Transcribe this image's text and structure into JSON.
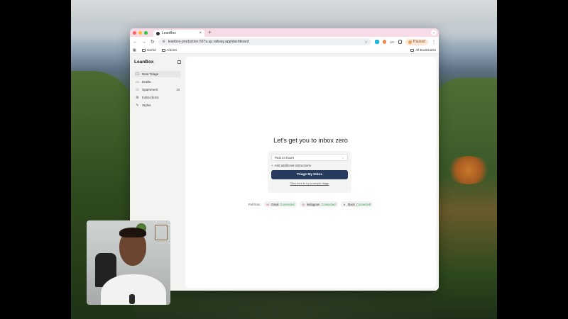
{
  "browser": {
    "tab_title": "LeanBox",
    "new_tab_glyph": "+",
    "close_glyph": "×",
    "url": "leanbox-production-597a.up.railway.app/dashboard",
    "profile_label": "Paused",
    "bookmarks": [
      "Useful",
      "Articles"
    ],
    "all_bookmarks_label": "All Bookmarks",
    "traffic_colors": [
      "#ff5f57",
      "#febc2e",
      "#28c840"
    ]
  },
  "sidebar": {
    "brand": "LeanBox",
    "items": [
      {
        "label": "New Triage",
        "icon": "chat-icon",
        "active": true
      },
      {
        "label": "Drafts",
        "icon": "file-icon"
      },
      {
        "label": "Spammers",
        "icon": "users-icon",
        "count": "18"
      },
      {
        "label": "Instructions",
        "icon": "gear-icon"
      },
      {
        "label": "Styles",
        "icon": "pen-icon"
      }
    ]
  },
  "main": {
    "headline": "Let's get you to inbox zero",
    "timeframe_value": "Past 24 hours",
    "add_instructions": "Add additional instructions",
    "cta_label": "Triage My Inbox",
    "sample_link": "Click here to try a sample triage",
    "pull_from_label": "Pull from:",
    "sources": [
      {
        "name": "Gmail",
        "status": "Connected",
        "icon": "gmail-icon"
      },
      {
        "name": "Instagram",
        "status": "Connected",
        "icon": "instagram-icon"
      },
      {
        "name": "Slack",
        "status": "Connected",
        "icon": "slack-icon"
      }
    ]
  },
  "colors": {
    "cta": "#273b5f",
    "connected": "#2f9b57",
    "tabbar": "#f7dbe6"
  }
}
